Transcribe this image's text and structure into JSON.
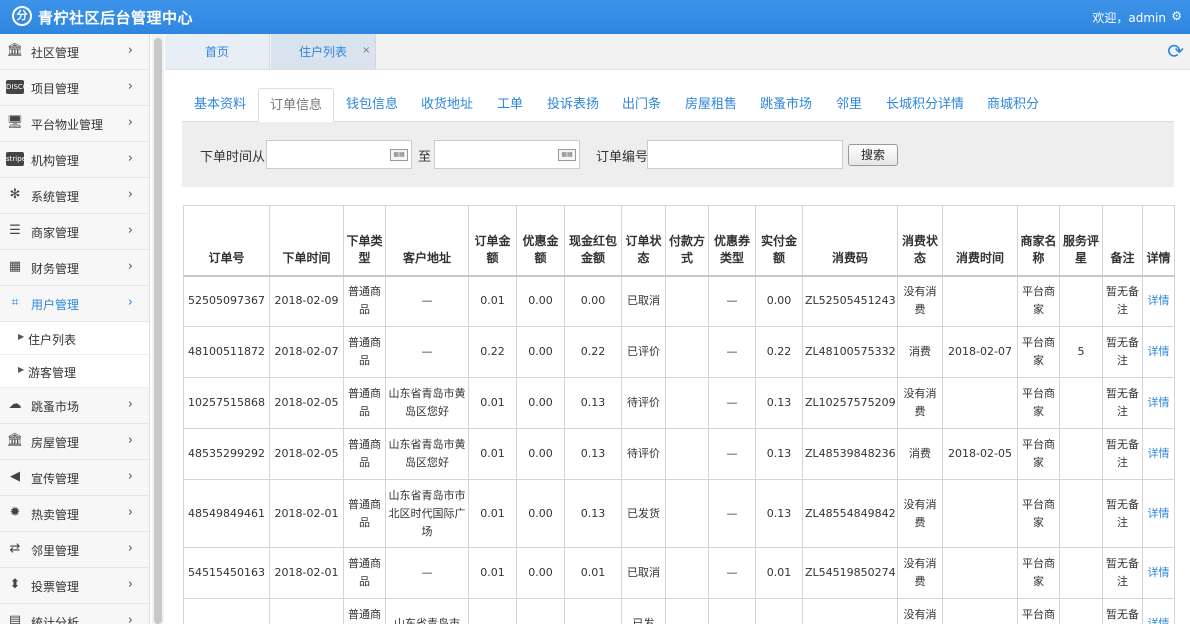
{
  "header": {
    "logo_glyph": "分",
    "title": "青柠社区后台管理中心",
    "welcome": "欢迎，admin",
    "gear_icon": "⚙"
  },
  "sidebar": {
    "items": [
      {
        "label": "社区管理",
        "icon": "bank-icon",
        "glyph": "🏛"
      },
      {
        "label": "项目管理",
        "icon": "discover-card-icon",
        "glyph": "DISCOVER"
      },
      {
        "label": "平台物业管理",
        "icon": "desktop-icon",
        "glyph": "🖥"
      },
      {
        "label": "机构管理",
        "icon": "stripe-icon",
        "glyph": "stripe"
      },
      {
        "label": "系统管理",
        "icon": "yelp-icon",
        "glyph": "✻"
      },
      {
        "label": "商家管理",
        "icon": "bars-icon",
        "glyph": "☰"
      },
      {
        "label": "财务管理",
        "icon": "calculator-icon",
        "glyph": "▦"
      },
      {
        "label": "用户管理",
        "icon": "crop-icon",
        "glyph": "⌗"
      }
    ],
    "sub_items": [
      {
        "label": "住户列表"
      },
      {
        "label": "游客管理"
      }
    ],
    "items_after": [
      {
        "label": "跳蚤市场",
        "icon": "cloud-icon",
        "glyph": "☁"
      },
      {
        "label": "房屋管理",
        "icon": "bank-icon",
        "glyph": "🏛"
      },
      {
        "label": "宣传管理",
        "icon": "volume-icon",
        "glyph": "◀"
      },
      {
        "label": "热卖管理",
        "icon": "sun-icon",
        "glyph": "✹"
      },
      {
        "label": "邻里管理",
        "icon": "retweet-icon",
        "glyph": "⇄"
      },
      {
        "label": "投票管理",
        "icon": "sort-icon",
        "glyph": "⬍"
      },
      {
        "label": "统计分析",
        "icon": "chart-icon",
        "glyph": "▤"
      }
    ],
    "chevron": "›"
  },
  "page_tabs": {
    "home": "首页",
    "list": "住户列表",
    "close": "×",
    "refresh_icon": "⟳"
  },
  "inner_tabs": [
    "基本资料",
    "订单信息",
    "钱包信息",
    "收货地址",
    "工单",
    "投诉表扬",
    "出门条",
    "房屋租售",
    "跳蚤市场",
    "邻里",
    "长城积分详情",
    "商城积分"
  ],
  "search": {
    "from_label": "下单时间从",
    "to_label": "至",
    "order_no_label": "订单编号",
    "button": "搜索",
    "from_value": "",
    "to_value": "",
    "order_no_value": ""
  },
  "table": {
    "headers": [
      "订单号",
      "下单时间",
      "下单类型",
      "客户地址",
      "订单金额",
      "优惠金额",
      "现金红包金额",
      "订单状态",
      "付款方式",
      "优惠券类型",
      "实付金额",
      "消费码",
      "消费状态",
      "消费时间",
      "商家名称",
      "服务评星",
      "备注",
      "详情"
    ],
    "rows": [
      [
        "52505097367",
        "2018-02-09",
        "普通商品",
        "—",
        "0.01",
        "0.00",
        "0.00",
        "已取消",
        "",
        "—",
        "0.00",
        "ZL52505451243",
        "没有消费",
        "",
        "平台商家",
        "",
        "暂无备注",
        "详情"
      ],
      [
        "48100511872",
        "2018-02-07",
        "普通商品",
        "—",
        "0.22",
        "0.00",
        "0.22",
        "已评价",
        "",
        "—",
        "0.22",
        "ZL48100575332",
        "消费",
        "2018-02-07",
        "平台商家",
        "5",
        "暂无备注",
        "详情"
      ],
      [
        "10257515868",
        "2018-02-05",
        "普通商品",
        "山东省青岛市黄岛区您好",
        "0.01",
        "0.00",
        "0.13",
        "待评价",
        "",
        "—",
        "0.13",
        "ZL10257575209",
        "没有消费",
        "",
        "平台商家",
        "",
        "暂无备注",
        "详情"
      ],
      [
        "48535299292",
        "2018-02-05",
        "普通商品",
        "山东省青岛市黄岛区您好",
        "0.01",
        "0.00",
        "0.13",
        "待评价",
        "",
        "—",
        "0.13",
        "ZL48539848236",
        "消费",
        "2018-02-05",
        "平台商家",
        "",
        "暂无备注",
        "详情"
      ],
      [
        "48549849461",
        "2018-02-01",
        "普通商品",
        "山东省青岛市市北区时代国际广场",
        "0.01",
        "0.00",
        "0.13",
        "已发货",
        "",
        "—",
        "0.13",
        "ZL48554849842",
        "没有消费",
        "",
        "平台商家",
        "",
        "暂无备注",
        "详情"
      ],
      [
        "54515450163",
        "2018-02-01",
        "普通商品",
        "—",
        "0.01",
        "0.00",
        "0.01",
        "已取消",
        "",
        "—",
        "0.01",
        "ZL54519850274",
        "没有消费",
        "",
        "平台商家",
        "",
        "暂无备注",
        "详情"
      ],
      [
        "",
        "",
        "普通商品",
        "山东省青岛市",
        "",
        "",
        "",
        "已发",
        "",
        "",
        "",
        "",
        "没有消费",
        "",
        "平台商家",
        "",
        "暂无备注",
        "详情"
      ]
    ]
  }
}
